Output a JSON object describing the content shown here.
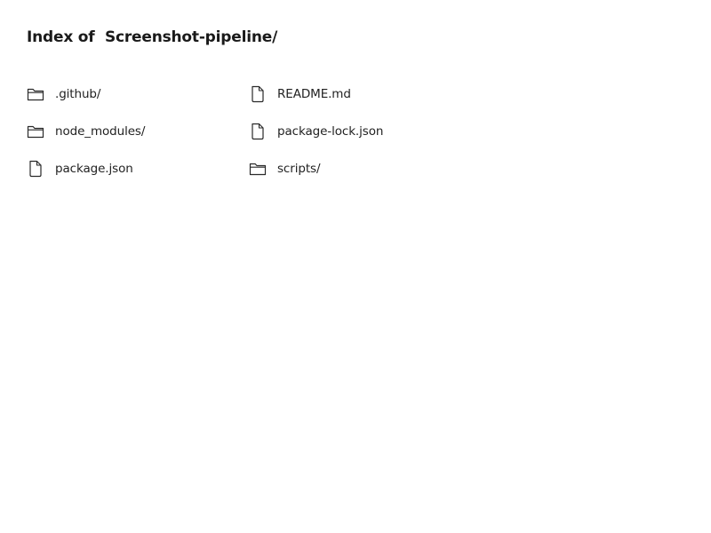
{
  "page": {
    "title_prefix": "Index of ",
    "title_path": "Screenshot-pipeline/"
  },
  "entries": [
    {
      "name": ".github/",
      "kind": "folder",
      "icon": "folder-icon"
    },
    {
      "name": "README.md",
      "kind": "file",
      "icon": "file-icon"
    },
    {
      "name": "node_modules/",
      "kind": "folder",
      "icon": "folder-icon"
    },
    {
      "name": "package-lock.json",
      "kind": "file",
      "icon": "file-icon"
    },
    {
      "name": "package.json",
      "kind": "file",
      "icon": "file-icon"
    },
    {
      "name": "scripts/",
      "kind": "folder",
      "icon": "folder-icon"
    }
  ],
  "colors": {
    "text": "#222222",
    "icon_stroke": "#2a2a2a",
    "background": "#ffffff"
  }
}
